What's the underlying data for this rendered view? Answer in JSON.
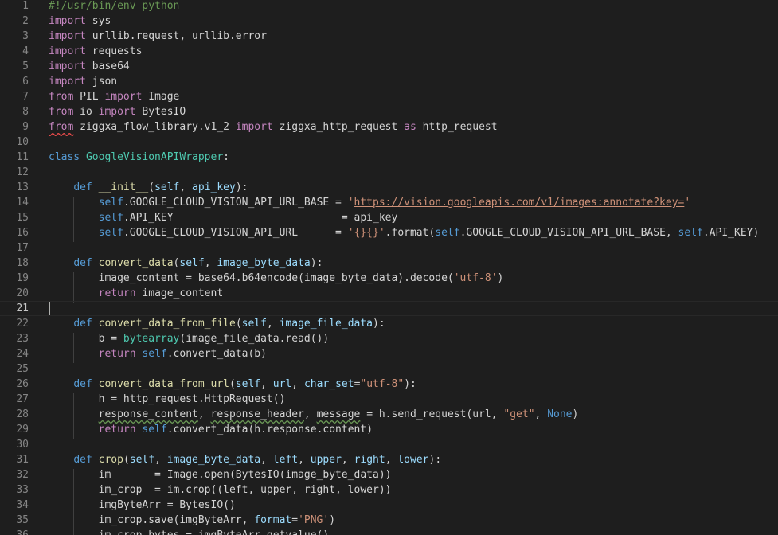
{
  "editor": {
    "lines": [
      {
        "n": "1",
        "segs": [
          [
            "cmt",
            "#!/usr/bin/env python"
          ]
        ]
      },
      {
        "n": "2",
        "segs": [
          [
            "ctl",
            "import"
          ],
          [
            "",
            " sys"
          ]
        ]
      },
      {
        "n": "3",
        "segs": [
          [
            "ctl",
            "import"
          ],
          [
            "",
            " urllib.request, urllib.error"
          ]
        ]
      },
      {
        "n": "4",
        "segs": [
          [
            "ctl",
            "import"
          ],
          [
            "",
            " requests"
          ]
        ]
      },
      {
        "n": "5",
        "segs": [
          [
            "ctl",
            "import"
          ],
          [
            "",
            " base64"
          ]
        ]
      },
      {
        "n": "6",
        "segs": [
          [
            "ctl",
            "import"
          ],
          [
            "",
            " json"
          ]
        ]
      },
      {
        "n": "7",
        "segs": [
          [
            "ctl",
            "from"
          ],
          [
            "",
            " PIL "
          ],
          [
            "ctl",
            "import"
          ],
          [
            "",
            " Image"
          ]
        ]
      },
      {
        "n": "8",
        "segs": [
          [
            "ctl",
            "from"
          ],
          [
            "",
            " io "
          ],
          [
            "ctl",
            "import"
          ],
          [
            "",
            " BytesIO"
          ]
        ]
      },
      {
        "n": "9",
        "segs": [
          [
            "ctl squig",
            "from"
          ],
          [
            "",
            " ziggxa_flow_library.v1_2 "
          ],
          [
            "ctl",
            "import"
          ],
          [
            "",
            " ziggxa_http_request "
          ],
          [
            "ctl",
            "as"
          ],
          [
            "",
            " http_request"
          ]
        ]
      },
      {
        "n": "10",
        "segs": []
      },
      {
        "n": "11",
        "segs": [
          [
            "kw",
            "class"
          ],
          [
            "",
            " "
          ],
          [
            "cls",
            "GoogleVisionAPIWrapper"
          ],
          [
            "",
            ":"
          ]
        ]
      },
      {
        "n": "12",
        "segs": []
      },
      {
        "n": "13",
        "segs": [
          [
            "",
            "    "
          ],
          [
            "kw",
            "def"
          ],
          [
            "",
            " "
          ],
          [
            "fn",
            "__init__"
          ],
          [
            "",
            "("
          ],
          [
            "par",
            "self"
          ],
          [
            "",
            ", "
          ],
          [
            "par",
            "api_key"
          ],
          [
            "",
            "):"
          ]
        ]
      },
      {
        "n": "14",
        "segs": [
          [
            "",
            "        "
          ],
          [
            "kw",
            "self"
          ],
          [
            "",
            ".GOOGLE_CLOUD_VISION_API_URL_BASE = "
          ],
          [
            "str",
            "'"
          ],
          [
            "str url",
            "https://vision.googleapis.com/v1/images:annotate?key="
          ],
          [
            "str",
            "'"
          ]
        ]
      },
      {
        "n": "15",
        "segs": [
          [
            "",
            "        "
          ],
          [
            "kw",
            "self"
          ],
          [
            "",
            ".API_KEY                           = api_key"
          ]
        ]
      },
      {
        "n": "16",
        "segs": [
          [
            "",
            "        "
          ],
          [
            "kw",
            "self"
          ],
          [
            "",
            ".GOOGLE_CLOUD_VISION_API_URL      = "
          ],
          [
            "str",
            "'{}{}'"
          ],
          [
            "",
            ".format("
          ],
          [
            "kw",
            "self"
          ],
          [
            "",
            ".GOOGLE_CLOUD_VISION_API_URL_BASE, "
          ],
          [
            "kw",
            "self"
          ],
          [
            "",
            ".API_KEY)"
          ]
        ]
      },
      {
        "n": "17",
        "segs": []
      },
      {
        "n": "18",
        "segs": [
          [
            "",
            "    "
          ],
          [
            "kw",
            "def"
          ],
          [
            "",
            " "
          ],
          [
            "fn",
            "convert_data"
          ],
          [
            "",
            "("
          ],
          [
            "par",
            "self"
          ],
          [
            "",
            ", "
          ],
          [
            "par",
            "image_byte_data"
          ],
          [
            "",
            "):"
          ]
        ]
      },
      {
        "n": "19",
        "segs": [
          [
            "",
            "        image_content = base64.b64encode(image_byte_data).decode("
          ],
          [
            "str",
            "'utf-8'"
          ],
          [
            "",
            ")"
          ]
        ]
      },
      {
        "n": "20",
        "segs": [
          [
            "",
            "        "
          ],
          [
            "ctl",
            "return"
          ],
          [
            "",
            " image_content"
          ]
        ]
      },
      {
        "n": "21",
        "segs": [],
        "current": true
      },
      {
        "n": "22",
        "segs": [
          [
            "",
            "    "
          ],
          [
            "kw",
            "def"
          ],
          [
            "",
            " "
          ],
          [
            "fn",
            "convert_data_from_file"
          ],
          [
            "",
            "("
          ],
          [
            "par",
            "self"
          ],
          [
            "",
            ", "
          ],
          [
            "par",
            "image_file_data"
          ],
          [
            "",
            "):"
          ]
        ]
      },
      {
        "n": "23",
        "segs": [
          [
            "",
            "        b = "
          ],
          [
            "cls",
            "bytearray"
          ],
          [
            "",
            "(image_file_data.read())"
          ]
        ]
      },
      {
        "n": "24",
        "segs": [
          [
            "",
            "        "
          ],
          [
            "ctl",
            "return"
          ],
          [
            "",
            " "
          ],
          [
            "kw",
            "self"
          ],
          [
            "",
            ".convert_data(b)"
          ]
        ]
      },
      {
        "n": "25",
        "segs": []
      },
      {
        "n": "26",
        "segs": [
          [
            "",
            "    "
          ],
          [
            "kw",
            "def"
          ],
          [
            "",
            " "
          ],
          [
            "fn",
            "convert_data_from_url"
          ],
          [
            "",
            "("
          ],
          [
            "par",
            "self"
          ],
          [
            "",
            ", "
          ],
          [
            "par",
            "url"
          ],
          [
            "",
            ", "
          ],
          [
            "par",
            "char_set"
          ],
          [
            "",
            "="
          ],
          [
            "str",
            "\"utf-8\""
          ],
          [
            "",
            "):"
          ]
        ]
      },
      {
        "n": "27",
        "segs": [
          [
            "",
            "        h = http_request.HttpRequest()"
          ]
        ]
      },
      {
        "n": "28",
        "segs": [
          [
            "",
            "        "
          ],
          [
            "warn",
            "response_content"
          ],
          [
            "",
            ", "
          ],
          [
            "warn",
            "response_header"
          ],
          [
            "",
            ", "
          ],
          [
            "warn",
            "message"
          ],
          [
            "",
            " = h.send_request(url, "
          ],
          [
            "str",
            "\"get\""
          ],
          [
            "",
            ", "
          ],
          [
            "kw",
            "None"
          ],
          [
            "",
            ")"
          ]
        ]
      },
      {
        "n": "29",
        "segs": [
          [
            "",
            "        "
          ],
          [
            "ctl",
            "return"
          ],
          [
            "",
            " "
          ],
          [
            "kw",
            "self"
          ],
          [
            "",
            ".convert_data(h.response.content)"
          ]
        ]
      },
      {
        "n": "30",
        "segs": []
      },
      {
        "n": "31",
        "segs": [
          [
            "",
            "    "
          ],
          [
            "kw",
            "def"
          ],
          [
            "",
            " "
          ],
          [
            "fn",
            "crop"
          ],
          [
            "",
            "("
          ],
          [
            "par",
            "self"
          ],
          [
            "",
            ", "
          ],
          [
            "par",
            "image_byte_data"
          ],
          [
            "",
            ", "
          ],
          [
            "par",
            "left"
          ],
          [
            "",
            ", "
          ],
          [
            "par",
            "upper"
          ],
          [
            "",
            ", "
          ],
          [
            "par",
            "right"
          ],
          [
            "",
            ", "
          ],
          [
            "par",
            "lower"
          ],
          [
            "",
            "):"
          ]
        ]
      },
      {
        "n": "32",
        "segs": [
          [
            "",
            "        im       = Image.open(BytesIO(image_byte_data))"
          ]
        ]
      },
      {
        "n": "33",
        "segs": [
          [
            "",
            "        im_crop  = im.crop((left, upper, right, lower))"
          ]
        ]
      },
      {
        "n": "34",
        "segs": [
          [
            "",
            "        imgByteArr = BytesIO()"
          ]
        ]
      },
      {
        "n": "35",
        "segs": [
          [
            "",
            "        im_crop.save(imgByteArr, "
          ],
          [
            "par",
            "format"
          ],
          [
            "",
            "="
          ],
          [
            "str",
            "'PNG'"
          ],
          [
            "",
            ")"
          ]
        ]
      },
      {
        "n": "36",
        "segs": [
          [
            "",
            "        im_crop_bytes = imgByteArr.getvalue()"
          ]
        ]
      }
    ]
  }
}
